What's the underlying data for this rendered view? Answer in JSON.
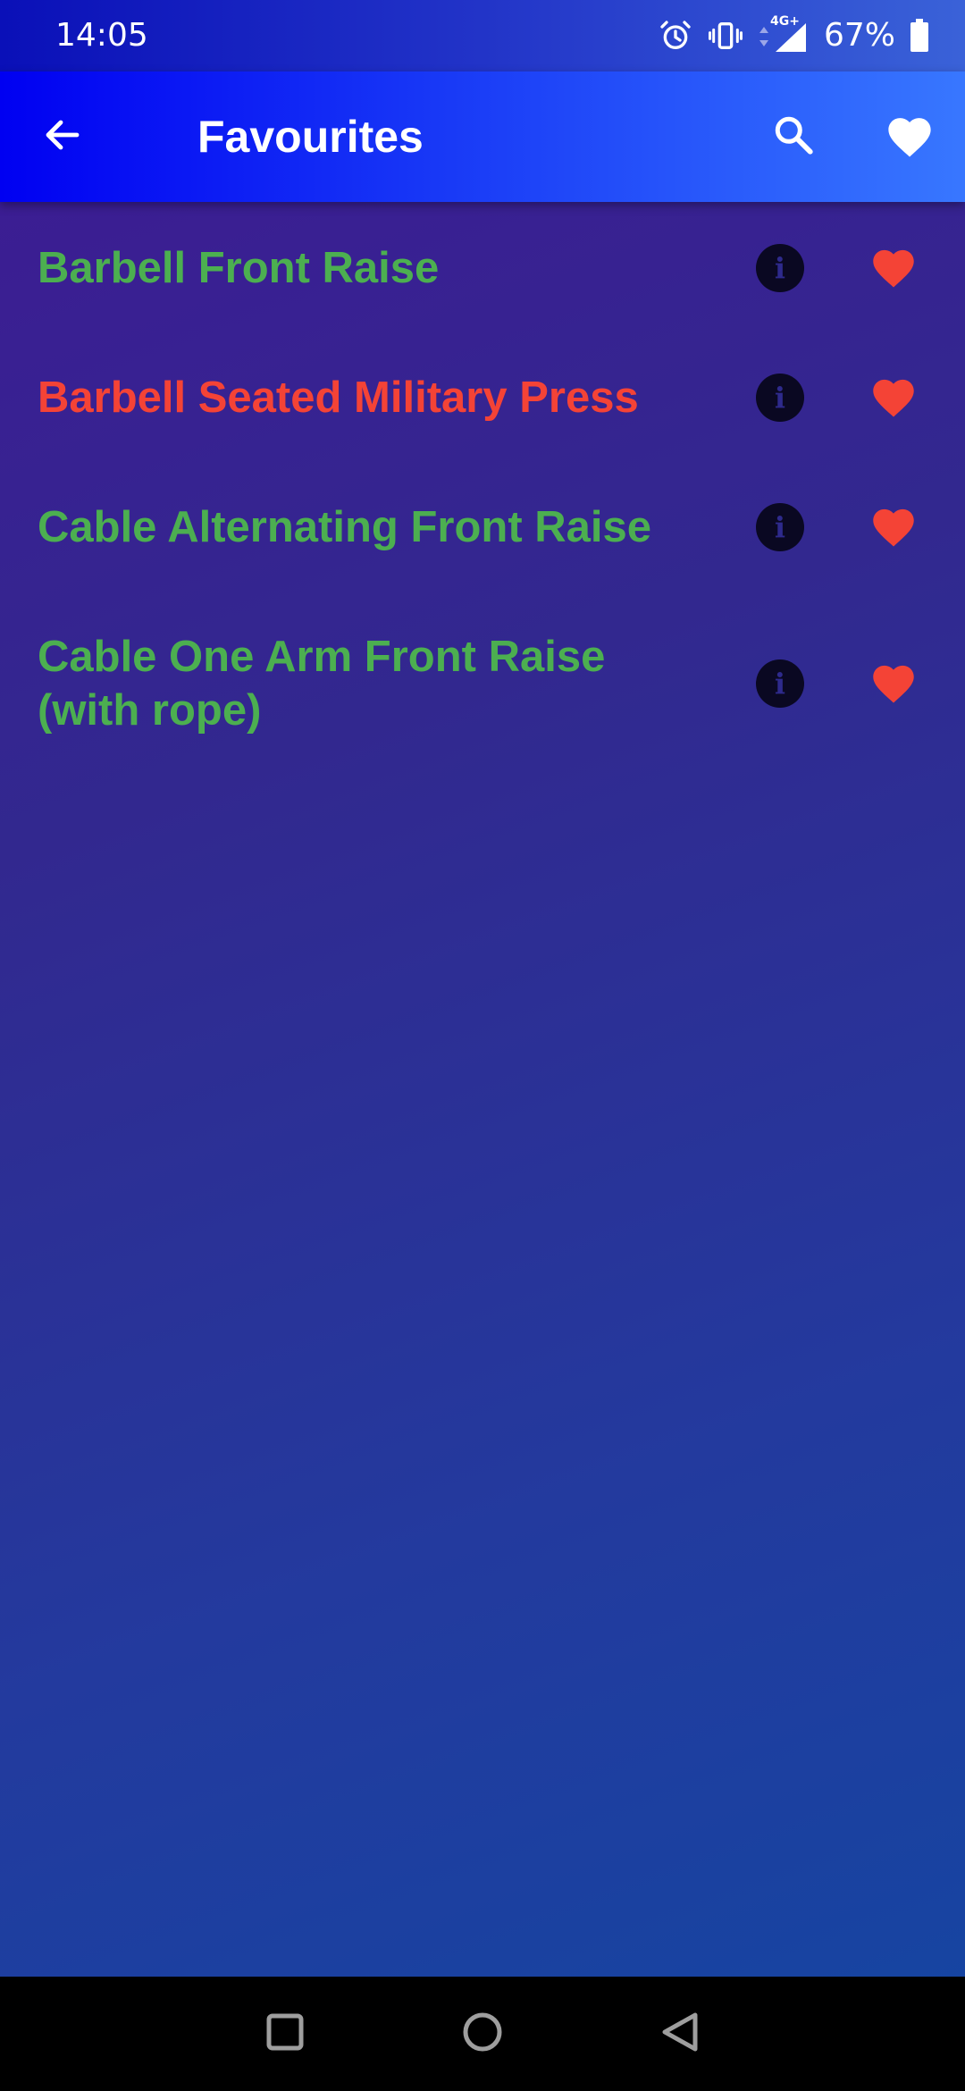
{
  "status_bar": {
    "time": "14:05",
    "network_label": "4G+",
    "battery_percent": "67%",
    "icons": [
      "alarm-icon",
      "vibrate-icon",
      "network-arrows-icon",
      "signal-icon",
      "battery-icon"
    ]
  },
  "app_bar": {
    "title": "Favourites",
    "icons": [
      "back-arrow-icon",
      "search-icon",
      "heart-icon"
    ]
  },
  "favourites": [
    {
      "name": "Barbell Front Raise",
      "line2": "",
      "color": "#4caf50"
    },
    {
      "name": "Barbell Seated Military Press",
      "line2": "",
      "color": "#f44336"
    },
    {
      "name": "Cable Alternating Front Raise",
      "line2": "",
      "color": "#4caf50"
    },
    {
      "name": "Cable One Arm Front Raise",
      "line2": "(with rope)",
      "color": "#4caf50"
    }
  ],
  "colors": {
    "heart": "#f44336",
    "green_text": "#4caf50",
    "red_text": "#f44336"
  },
  "nav_bar": {
    "icons": [
      "recents-square-icon",
      "home-circle-icon",
      "back-triangle-icon"
    ]
  }
}
